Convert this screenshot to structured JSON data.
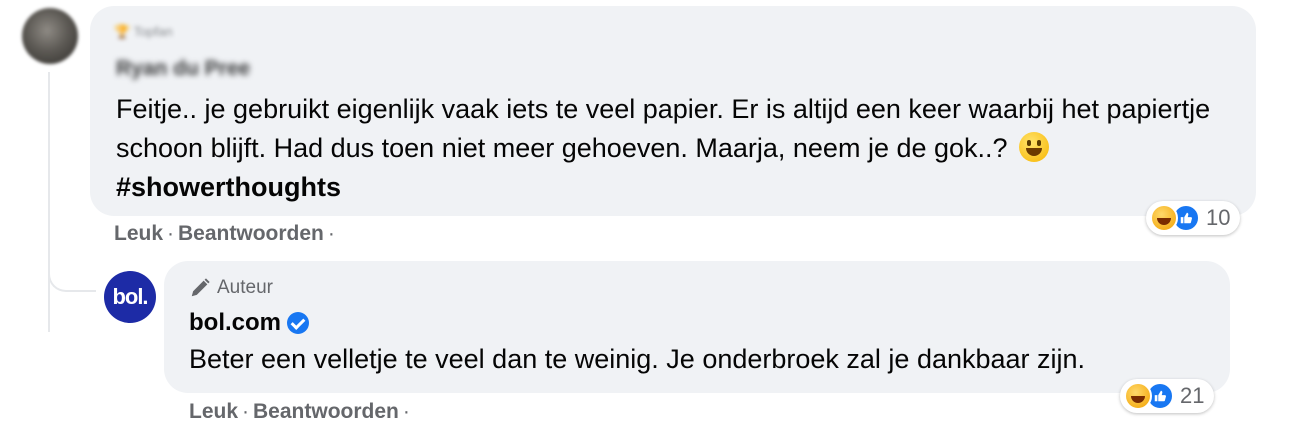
{
  "comment": {
    "badge_label": "Topfan",
    "author_name": "Ryan du Pree",
    "text": "Feitje.. je gebruikt eigenlijk vaak iets te veel papier. Er is altijd een keer waarbij het papiertje schoon blijft. Had dus toen niet meer gehoeven. Maarja, neem je de gok..?",
    "emoji_icon": "grinning-face",
    "hashtag": "#showerthoughts",
    "like_label": "Leuk",
    "reply_label": "Beantwoorden",
    "separator": "·",
    "reactions": {
      "icons": [
        "haha-reaction-icon",
        "like-reaction-icon"
      ],
      "count": "10"
    }
  },
  "reply": {
    "avatar_text": "bol.",
    "role_label": "Auteur",
    "author_name": "bol.com",
    "verified": true,
    "text": "Beter een velletje te veel dan te weinig. Je onderbroek zal je dankbaar zijn.",
    "like_label": "Leuk",
    "reply_label": "Beantwoorden",
    "separator": "·",
    "reactions": {
      "icons": [
        "haha-reaction-icon",
        "like-reaction-icon"
      ],
      "count": "21"
    }
  },
  "colors": {
    "bubble_bg": "#f0f2f5",
    "meta_text": "#65676b",
    "brand_blue": "#1877f2",
    "bol_avatar": "#1d2ba6"
  }
}
